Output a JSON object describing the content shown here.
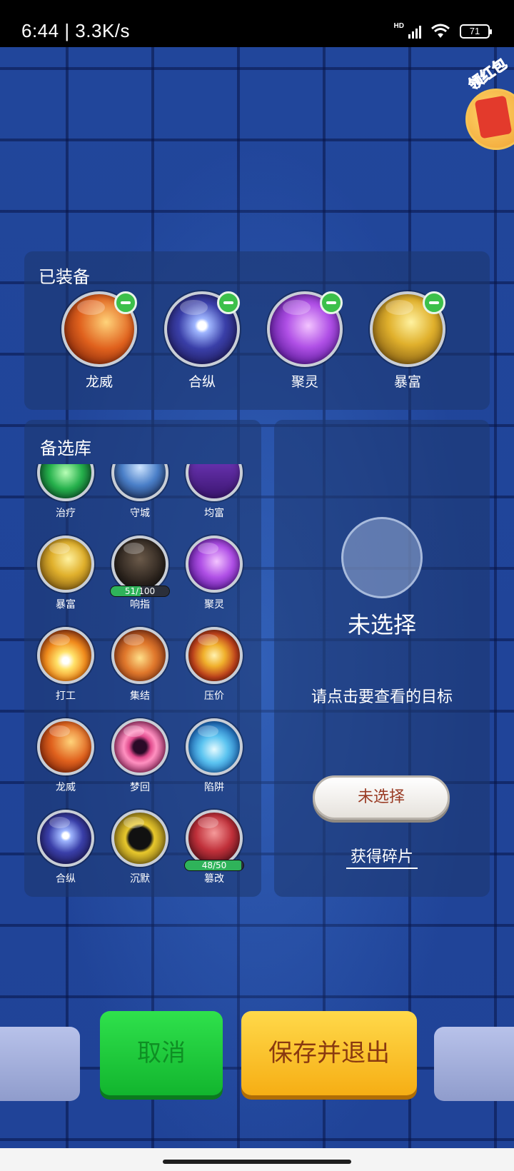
{
  "status_bar": {
    "time_speed": "6:44 | 3.3K/s",
    "network": "HD",
    "battery": "71"
  },
  "red_packet": {
    "label": "领红包"
  },
  "equipped": {
    "title": "已装备",
    "items": [
      {
        "name": "龙威",
        "icon": "longwei-icon"
      },
      {
        "name": "合纵",
        "icon": "hezong-icon"
      },
      {
        "name": "聚灵",
        "icon": "juling-icon"
      },
      {
        "name": "暴富",
        "icon": "baofu-icon"
      }
    ]
  },
  "library": {
    "title": "备选库",
    "items": [
      {
        "name": "治疗"
      },
      {
        "name": "守城"
      },
      {
        "name": "均富"
      },
      {
        "name": "暴富"
      },
      {
        "name": "响指",
        "progress": "51/100",
        "progress_fraction": 0.51
      },
      {
        "name": "聚灵"
      },
      {
        "name": "打工"
      },
      {
        "name": "集结"
      },
      {
        "name": "压价"
      },
      {
        "name": "龙威"
      },
      {
        "name": "梦回"
      },
      {
        "name": "陷阱"
      },
      {
        "name": "合纵"
      },
      {
        "name": "沉默"
      },
      {
        "name": "篡改",
        "progress": "48/50",
        "progress_fraction": 0.96
      }
    ]
  },
  "detail": {
    "title": "未选择",
    "hint": "请点击要查看的目标",
    "button": "未选择",
    "get_fragments": "获得碎片"
  },
  "buttons": {
    "cancel": "取消",
    "save_exit": "保存并退出"
  },
  "colors": {
    "background": "#21469b",
    "cancel_green": "#12b52e",
    "save_yellow": "#f6ae14",
    "minus_green": "#3cc04a",
    "progress_green": "#2fb35a"
  }
}
